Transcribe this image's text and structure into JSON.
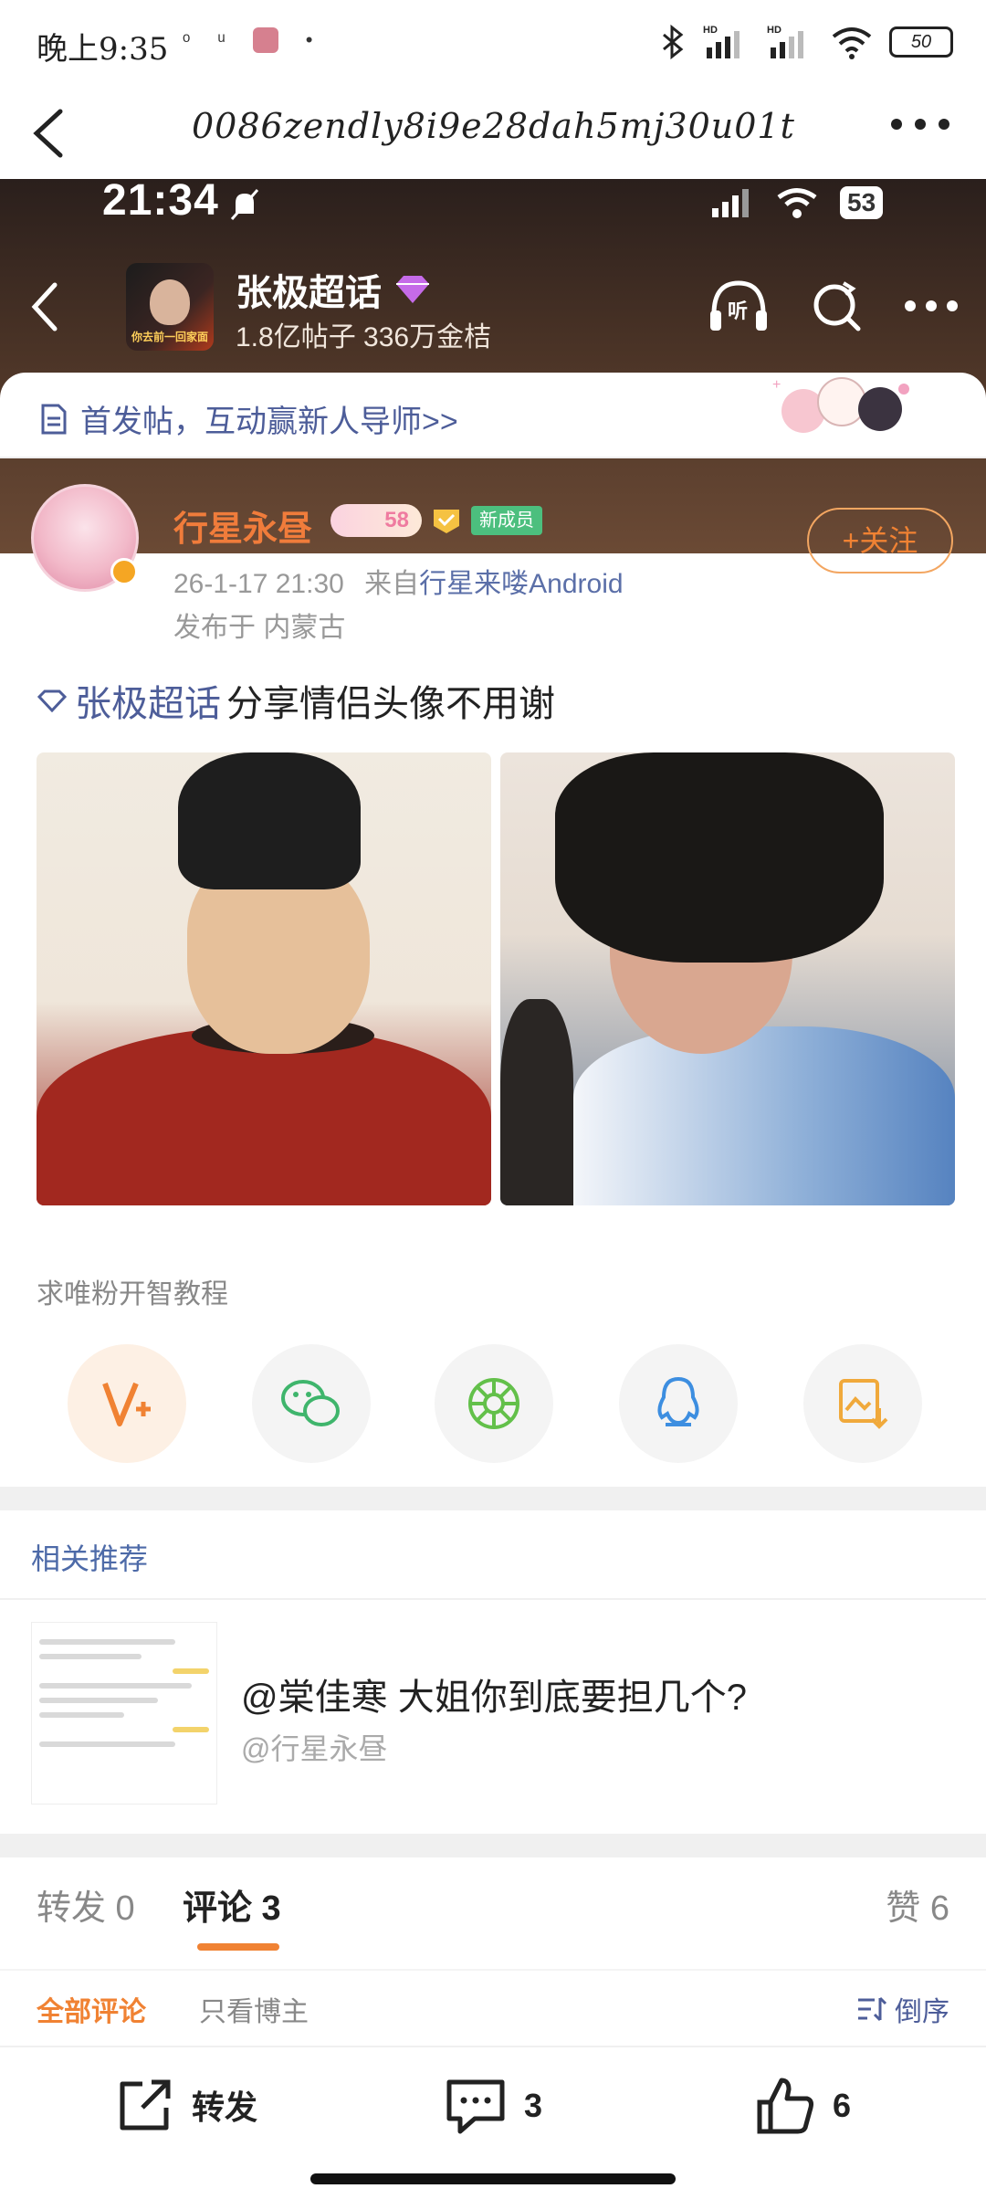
{
  "os_status": {
    "time": "晚上9:35",
    "notif_icons": [
      "weibo-icon",
      "glyph-icon",
      "app-icon",
      "dot"
    ],
    "hd1": "HD",
    "hd2": "HD",
    "battery": "50"
  },
  "os_title": {
    "url": "0086zendly8i9e28dah5mj30u01t…"
  },
  "inner_status": {
    "time": "21:34",
    "battery": "53"
  },
  "hero": {
    "title": "张极超话",
    "subtitle": "1.8亿帖子 336万金桔",
    "thumb_caption": "你去前一回家面"
  },
  "banner": {
    "text": "首发帖，互动赢新人导师>>"
  },
  "post": {
    "username": "行星永昼",
    "level": "58",
    "new_badge": "新成员",
    "date": "26-1-17 21:30",
    "source_prefix": "来自",
    "source": "行星来喽Android",
    "location": "发布于 内蒙古",
    "follow_label": "+关注",
    "topic": "张极超话",
    "text": "分享情侣头像不用谢",
    "tutorial": "求唯粉开智教程"
  },
  "share": {
    "items": [
      "weibo-forward-icon",
      "wechat-icon",
      "moments-icon",
      "qq-icon",
      "save-image-icon"
    ]
  },
  "related": {
    "title": "相关推荐",
    "item_title": "@棠佳寒 大姐你到底要担几个?",
    "item_author": "@行星永昼"
  },
  "tabs": {
    "forward": "转发 0",
    "comments": "评论 3",
    "likes": "赞 6"
  },
  "sub_tabs": {
    "all": "全部评论",
    "author_only": "只看博主",
    "order": "倒序"
  },
  "actions": {
    "forward": "转发",
    "comment_count": "3",
    "like_count": "6"
  },
  "colors": {
    "accent": "#f08233",
    "topic_blue": "#4d5d99",
    "new_badge": "#4cbf7e"
  }
}
